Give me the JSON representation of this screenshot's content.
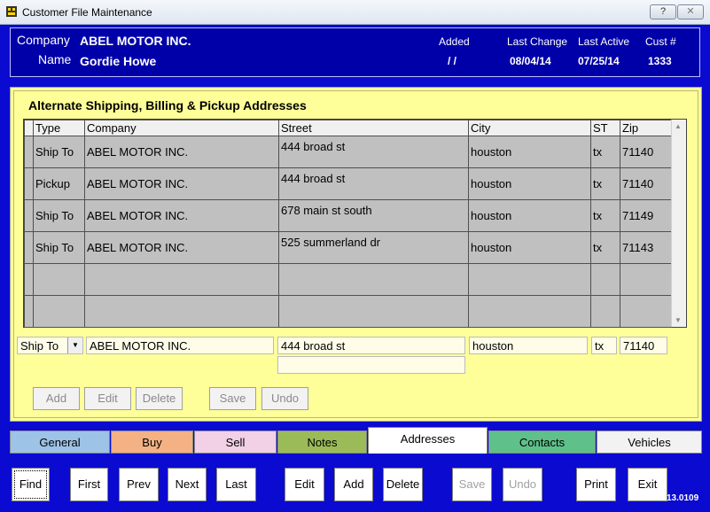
{
  "window": {
    "title": "Customer File Maintenance",
    "help_label": "?",
    "close_label": "✕"
  },
  "header": {
    "company_label": "Company",
    "company_value": "ABEL MOTOR INC.",
    "name_label": "Name",
    "name_value": "Gordie Howe",
    "added_label": "Added",
    "added_value": "/ /",
    "last_change_label": "Last Change",
    "last_change_value": "08/04/14",
    "last_active_label": "Last Active",
    "last_active_value": "07/25/14",
    "cust_label": "Cust #",
    "cust_value": "1333"
  },
  "section_title": "Alternate  Shipping, Billing & Pickup Addresses",
  "grid": {
    "columns": [
      "Type",
      "Company",
      "Street",
      "City",
      "ST",
      "Zip"
    ],
    "rows": [
      [
        "Ship To",
        "ABEL MOTOR INC.",
        "444 broad st",
        "houston",
        "tx",
        "71140"
      ],
      [
        "Pickup",
        "ABEL MOTOR INC.",
        "444 broad st",
        "houston",
        "tx",
        "71140"
      ],
      [
        "Ship To",
        "ABEL MOTOR INC.",
        "678 main st south",
        "houston",
        "tx",
        "71149"
      ],
      [
        "Ship To",
        "ABEL MOTOR INC.",
        "525 summerland dr",
        "houston",
        "tx",
        "71143"
      ],
      [
        "",
        "",
        "",
        "",
        "",
        ""
      ],
      [
        "",
        "",
        "",
        "",
        "",
        ""
      ]
    ]
  },
  "edit": {
    "type": "Ship To",
    "company": "ABEL MOTOR INC.",
    "street": "444 broad st",
    "street2": "",
    "city": "houston",
    "st": "tx",
    "zip": "71140"
  },
  "address_buttons": {
    "add": "Add",
    "edit": "Edit",
    "delete": "Delete",
    "save": "Save",
    "undo": "Undo"
  },
  "tabs": [
    {
      "label": "General",
      "color": "#9dc3e6"
    },
    {
      "label": "Buy",
      "color": "#f4b183"
    },
    {
      "label": "Sell",
      "color": "#f2d0e6"
    },
    {
      "label": "Notes",
      "color": "#9bbb59"
    },
    {
      "label": "Addresses",
      "color": "#ffffff"
    },
    {
      "label": "Contacts",
      "color": "#5fc08a"
    },
    {
      "label": "Vehicles",
      "color": "#f2f2f2"
    }
  ],
  "bottom_buttons": {
    "find": "Find",
    "first": "First",
    "prev": "Prev",
    "next": "Next",
    "last": "Last",
    "edit": "Edit",
    "add": "Add",
    "delete": "Delete",
    "save": "Save",
    "undo": "Undo",
    "print": "Print",
    "exit": "Exit"
  },
  "version": "13.0109"
}
